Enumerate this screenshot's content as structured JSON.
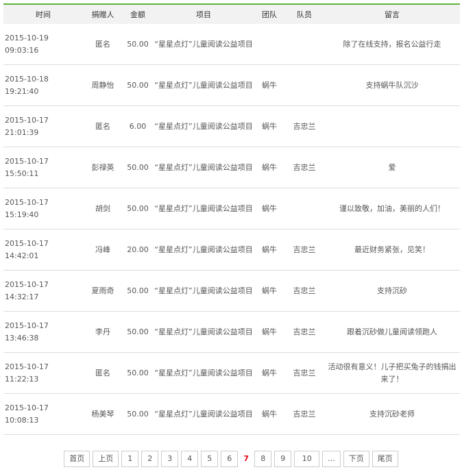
{
  "columns": [
    "时间",
    "捐赠人",
    "金额",
    "项目",
    "团队",
    "队员",
    "留言"
  ],
  "rows": [
    {
      "time": "2015-10-19 09:03:16",
      "donor": "匿名",
      "amount": "50.00",
      "project": "“星星点灯”儿童阅读公益项目",
      "team": "",
      "member": "",
      "message": "除了在线支持，报名公益行走"
    },
    {
      "time": "2015-10-18 19:21:40",
      "donor": "周静怡",
      "amount": "50.00",
      "project": "“星星点灯”儿童阅读公益项目",
      "team": "蜗牛",
      "member": "",
      "message": "支持蜗牛队沉沙"
    },
    {
      "time": "2015-10-17 21:01:39",
      "donor": "匿名",
      "amount": "6.00",
      "project": "“星星点灯”儿童阅读公益项目",
      "team": "蜗牛",
      "member": "吉忠兰",
      "message": ""
    },
    {
      "time": "2015-10-17 15:50:11",
      "donor": "彭禄英",
      "amount": "50.00",
      "project": "“星星点灯”儿童阅读公益项目",
      "team": "蜗牛",
      "member": "吉忠兰",
      "message": "爱"
    },
    {
      "time": "2015-10-17 15:19:40",
      "donor": "胡剑",
      "amount": "50.00",
      "project": "“星星点灯”儿童阅读公益项目",
      "team": "蜗牛",
      "member": "",
      "message": "谨以致敬，加油，美丽的人们！"
    },
    {
      "time": "2015-10-17 14:42:01",
      "donor": "冯峰",
      "amount": "20.00",
      "project": "“星星点灯”儿童阅读公益项目",
      "team": "蜗牛",
      "member": "吉忠兰",
      "message": "最近财务紧张，见笑！"
    },
    {
      "time": "2015-10-17 14:32:17",
      "donor": "夏雨奇",
      "amount": "50.00",
      "project": "“星星点灯”儿童阅读公益项目",
      "team": "蜗牛",
      "member": "吉忠兰",
      "message": "支持沉砂"
    },
    {
      "time": "2015-10-17 13:46:38",
      "donor": "李丹",
      "amount": "50.00",
      "project": "“星星点灯”儿童阅读公益项目",
      "team": "蜗牛",
      "member": "吉忠兰",
      "message": "跟着沉砂做儿童阅读领跑人"
    },
    {
      "time": "2015-10-17 11:22:13",
      "donor": "匿名",
      "amount": "50.00",
      "project": "“星星点灯”儿童阅读公益项目",
      "team": "蜗牛",
      "member": "吉忠兰",
      "message": "活动很有意义！儿子把买兔子的钱捐出来了！"
    },
    {
      "time": "2015-10-17 10:08:13",
      "donor": "杨美琴",
      "amount": "50.00",
      "project": "“星星点灯”儿童阅读公益项目",
      "team": "蜗牛",
      "member": "吉忠兰",
      "message": "支持沉砂老师"
    }
  ],
  "pagination": {
    "first": "首页",
    "prev": "上页",
    "pages": [
      "1",
      "2",
      "3",
      "4",
      "5",
      "6",
      "7",
      "8",
      "9",
      "10"
    ],
    "current": "7",
    "ellipsis": "...",
    "next": "下页",
    "last": "尾页"
  },
  "colors": {
    "accent_line": "#5fb13a",
    "header_bg": "#f2f2f2",
    "current_page": "#e60012"
  }
}
